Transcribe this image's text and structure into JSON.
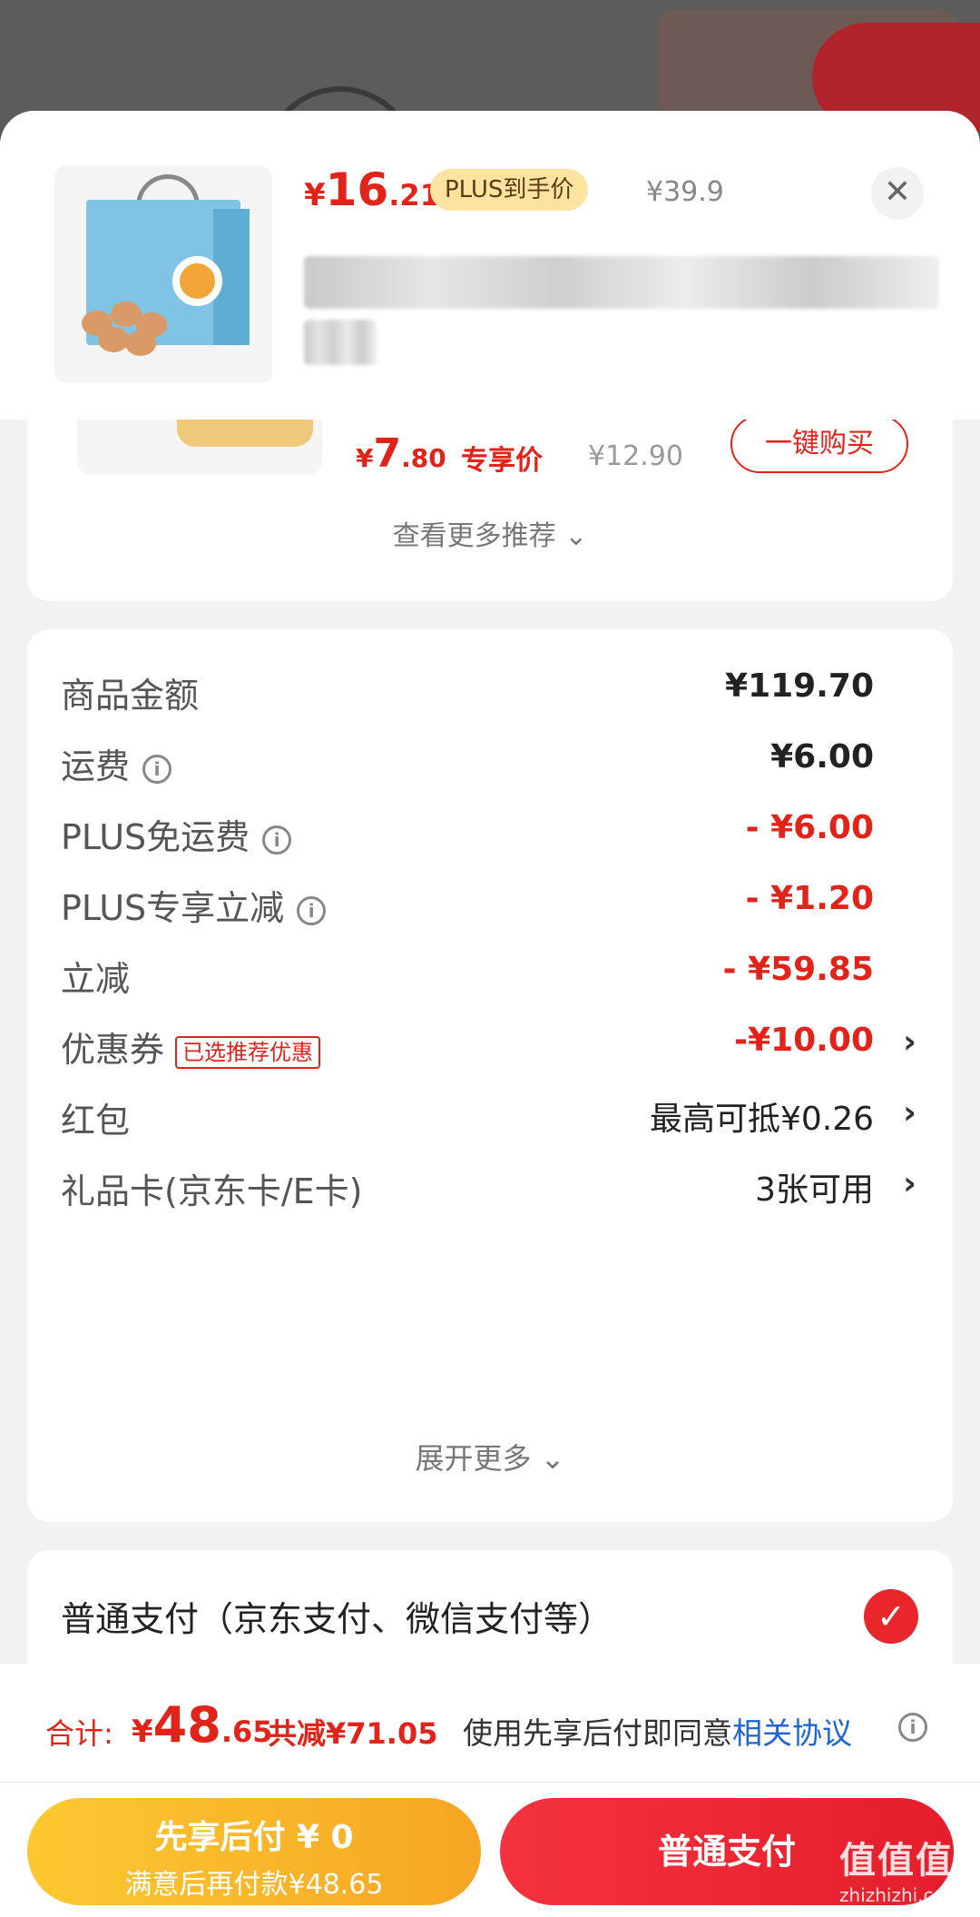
{
  "product": {
    "price_currency": "¥",
    "price_int": "16",
    "price_dec": ".21",
    "plus_tag": "PLUS到手价",
    "original_price": "¥39.9",
    "close_label": "✕"
  },
  "recommendation": {
    "price_currency": "¥",
    "price_int": "7",
    "price_dec": ".80",
    "tag": "专享价",
    "original_price": "¥12.90",
    "buy_label": "一键购买",
    "more_label": "查看更多推荐 ⌄"
  },
  "details": {
    "rows": [
      {
        "label": "商品金额",
        "value": "¥119.70"
      },
      {
        "label": "运费",
        "value": "¥6.00"
      },
      {
        "label": "PLUS免运费",
        "value": "- ¥6.00"
      },
      {
        "label": "PLUS专享立减",
        "value": "- ¥1.20"
      },
      {
        "label": "立减",
        "value": "- ¥59.85"
      },
      {
        "label": "优惠券",
        "tag": "已选推荐优惠",
        "value": "-¥10.00"
      },
      {
        "label": "红包",
        "value": "最高可抵¥0.26"
      },
      {
        "label": "礼品卡(京东卡/E卡)",
        "value": "3张可用"
      }
    ],
    "expand_label": "展开更多 ⌄",
    "info_glyph": "i",
    "chevron_glyph": "›"
  },
  "payment": {
    "method_label": "普通支付（京东支付、微信支付等）",
    "check_glyph": "✓"
  },
  "footer": {
    "sum_label": "合计:",
    "sum_currency": "¥",
    "sum_int": "48",
    "sum_dec": ".65",
    "saved": "共减¥71.05",
    "agree_text": "使用先享后付即同意",
    "agree_link": "相关协议",
    "pay_later_line1": "先享后付 ¥ 0",
    "pay_later_line2": "满意后再付款¥48.65",
    "pay_normal": "普通支付",
    "watermark": "值值值",
    "watermark_sub": "zhizhizhi.com"
  },
  "colors": {
    "accent_red": "#e2231a",
    "plus_gold": "#fbe3a0",
    "pay_later_yellow": "#f6a623",
    "link_blue": "#1e64d2"
  }
}
